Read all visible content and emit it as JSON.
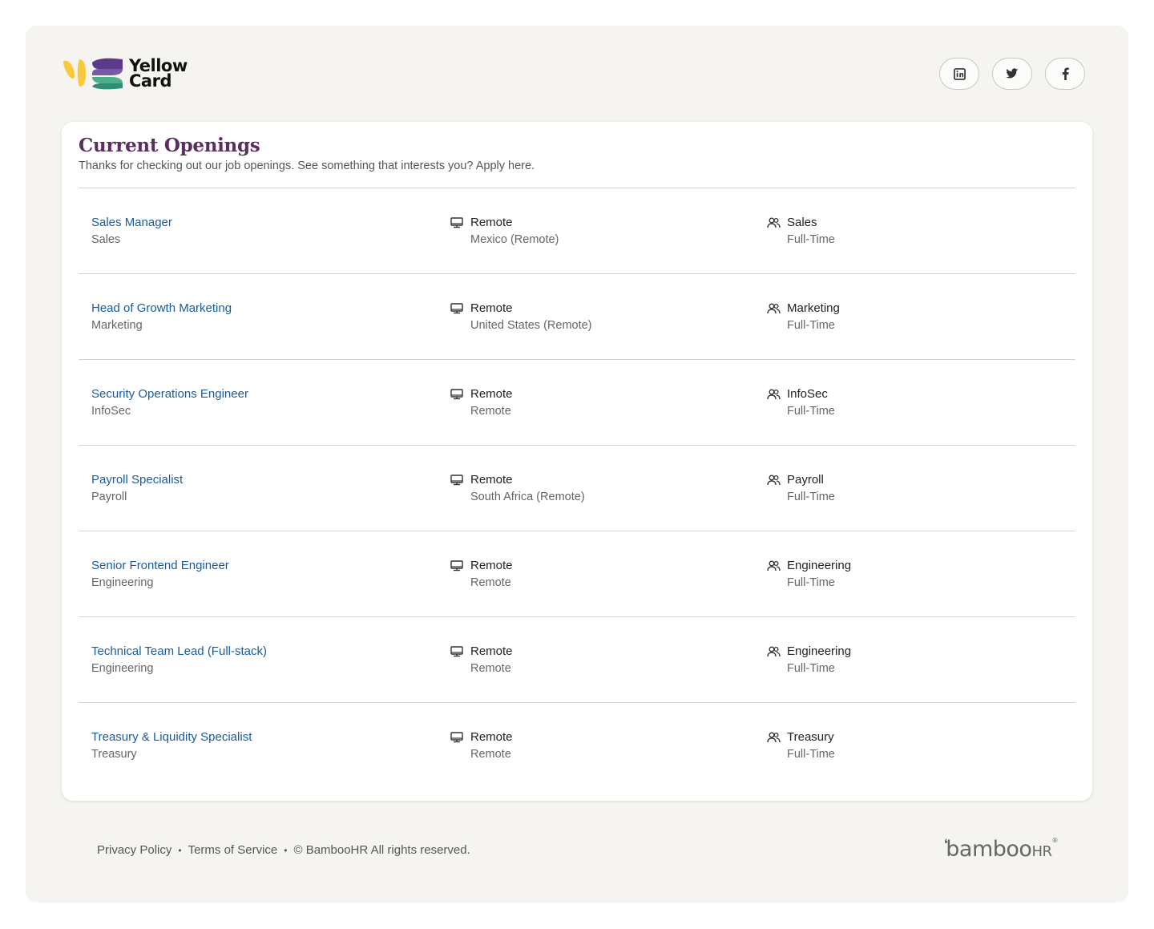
{
  "brand": {
    "name_line1": "Yellow",
    "name_line2": "Card",
    "colors": {
      "yellow": "#f8c93b",
      "purple": "#5b3a8c",
      "green": "#4fae8a"
    }
  },
  "socials": [
    {
      "icon": "linkedin-icon"
    },
    {
      "icon": "twitter-icon"
    },
    {
      "icon": "facebook-icon"
    }
  ],
  "openings": {
    "title": "Current Openings",
    "subtitle": "Thanks for checking out our job openings. See something that interests you? Apply here.",
    "jobs": [
      {
        "title": "Sales Manager",
        "department": "Sales",
        "location_type": "Remote",
        "location": "Mexico (Remote)",
        "team": "Sales",
        "employment": "Full-Time"
      },
      {
        "title": "Head of Growth Marketing",
        "department": "Marketing",
        "location_type": "Remote",
        "location": "United States (Remote)",
        "team": "Marketing",
        "employment": "Full-Time"
      },
      {
        "title": "Security Operations Engineer",
        "department": "InfoSec",
        "location_type": "Remote",
        "location": "Remote",
        "team": "InfoSec",
        "employment": "Full-Time"
      },
      {
        "title": "Payroll Specialist",
        "department": "Payroll",
        "location_type": "Remote",
        "location": "South Africa (Remote)",
        "team": "Payroll",
        "employment": "Full-Time"
      },
      {
        "title": "Senior Frontend Engineer",
        "department": "Engineering",
        "location_type": "Remote",
        "location": "Remote",
        "team": "Engineering",
        "employment": "Full-Time"
      },
      {
        "title": "Technical Team Lead (Full-stack)",
        "department": "Engineering",
        "location_type": "Remote",
        "location": "Remote",
        "team": "Engineering",
        "employment": "Full-Time"
      },
      {
        "title": "Treasury & Liquidity Specialist",
        "department": "Treasury",
        "location_type": "Remote",
        "location": "Remote",
        "team": "Treasury",
        "employment": "Full-Time"
      }
    ]
  },
  "footer": {
    "privacy": "Privacy Policy",
    "separator": "•",
    "terms": "Terms of Service",
    "copyright": "© BambooHR All rights reserved.",
    "powered_by_main": "bamboo",
    "powered_by_suffix": "HR",
    "powered_by_mark": "®"
  }
}
